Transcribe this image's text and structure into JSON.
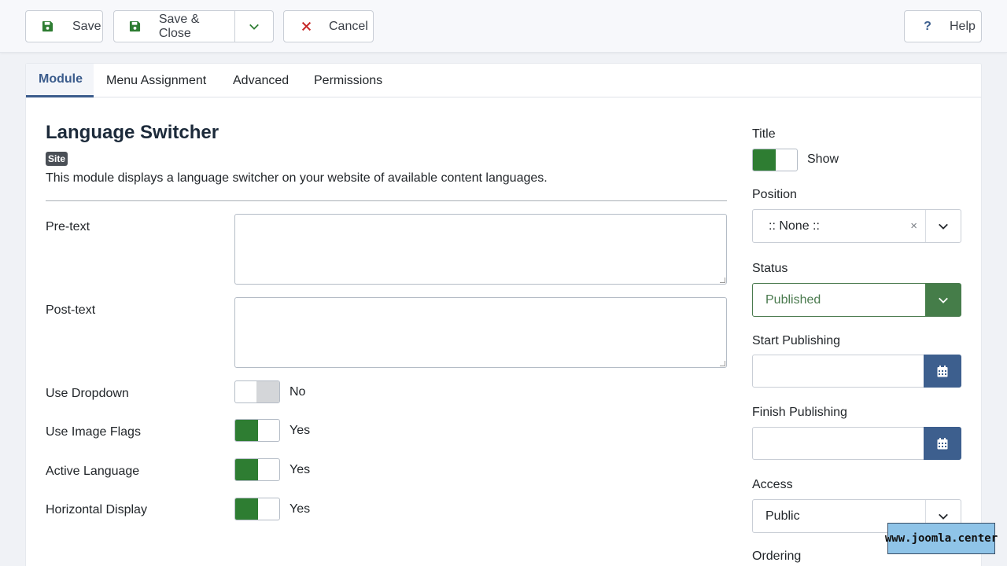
{
  "toolbar": {
    "save_label": "Save",
    "save_close_label": "Save & Close",
    "cancel_label": "Cancel",
    "help_label": "Help"
  },
  "tabs": [
    {
      "label": "Module",
      "active": true
    },
    {
      "label": "Menu Assignment",
      "active": false
    },
    {
      "label": "Advanced",
      "active": false
    },
    {
      "label": "Permissions",
      "active": false
    }
  ],
  "module": {
    "title": "Language Switcher",
    "badge": "Site",
    "description": "This module displays a language switcher on your website of available content languages."
  },
  "fields": {
    "pretext_label": "Pre-text",
    "posttext_label": "Post-text",
    "use_dropdown": {
      "label": "Use Dropdown",
      "value": "No",
      "on": false
    },
    "use_image_flags": {
      "label": "Use Image Flags",
      "value": "Yes",
      "on": true
    },
    "active_language": {
      "label": "Active Language",
      "value": "Yes",
      "on": true
    },
    "horizontal_display": {
      "label": "Horizontal Display",
      "value": "Yes",
      "on": true
    }
  },
  "sidebar": {
    "title_label": "Title",
    "title_value": "Show",
    "position_label": "Position",
    "position_value": ":: None ::",
    "status_label": "Status",
    "status_value": "Published",
    "start_label": "Start Publishing",
    "finish_label": "Finish Publishing",
    "access_label": "Access",
    "access_value": "Public",
    "ordering_label": "Ordering"
  },
  "watermark": "www.joomla.center",
  "colors": {
    "switch_on": "#2e7d32",
    "status_green": "#457d49",
    "calendar_blue": "#3d5f8e",
    "tab_active": "#3b5c8c"
  }
}
